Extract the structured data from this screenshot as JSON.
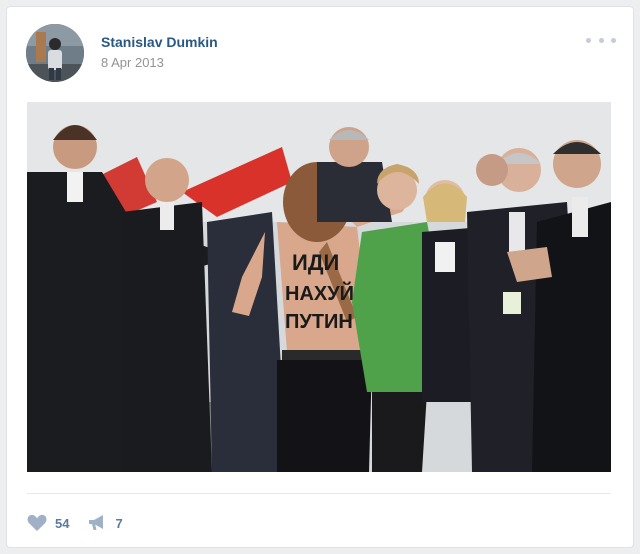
{
  "post": {
    "author_name": "Stanislav Dumkin",
    "date": "8 Apr 2013",
    "photo": {
      "body_text_line1": "ИДИ",
      "body_text_line2": "НАХУЙ",
      "body_text_line3": "ПУТИН"
    }
  },
  "footer": {
    "likes_count": "54",
    "shares_count": "7"
  },
  "icons": {
    "like": "heart-icon",
    "share": "megaphone-icon",
    "more": "more-dots-icon"
  },
  "colors": {
    "link": "#2a5885",
    "count": "#5b7aa1",
    "icon": "#a0b1c7"
  }
}
